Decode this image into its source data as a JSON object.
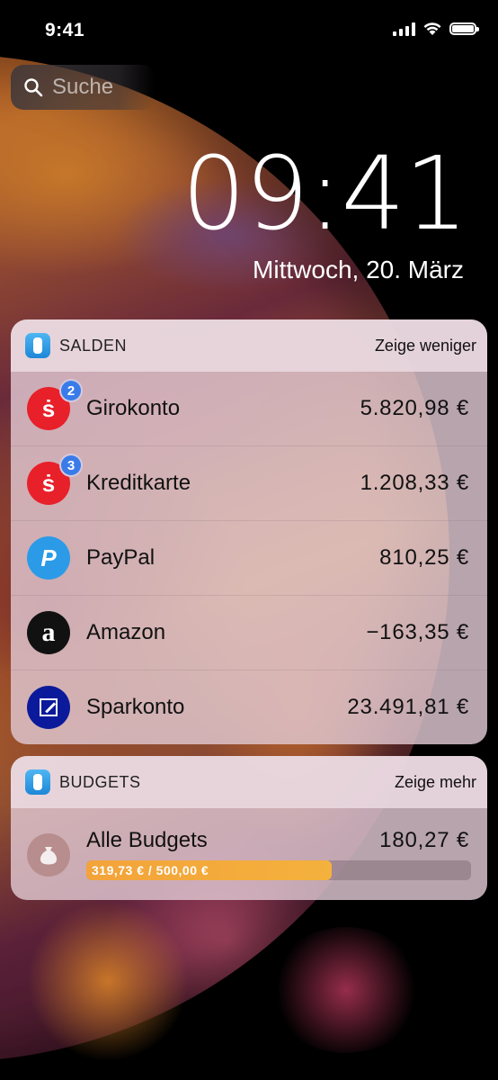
{
  "status_bar": {
    "time": "9:41"
  },
  "search": {
    "placeholder": "Suche"
  },
  "lock_screen": {
    "clock": "09:41",
    "date": "Mittwoch, 20. März"
  },
  "salden": {
    "title": "SALDEN",
    "action": "Zeige weniger",
    "accounts": [
      {
        "name": "Girokonto",
        "balance": "5.820,98 €",
        "badge": "2",
        "icon": "sparkasse-icon"
      },
      {
        "name": "Kreditkarte",
        "balance": "1.208,33 €",
        "badge": "3",
        "icon": "sparkasse-icon"
      },
      {
        "name": "PayPal",
        "balance": "810,25 €",
        "icon": "paypal-icon"
      },
      {
        "name": "Amazon",
        "balance": "−163,35 €",
        "icon": "amazon-icon"
      },
      {
        "name": "Sparkonto",
        "balance": "23.491,81 €",
        "icon": "deutsche-bank-icon"
      }
    ]
  },
  "budgets": {
    "title": "BUDGETS",
    "action": "Zeige mehr",
    "item": {
      "name": "Alle Budgets",
      "remaining": "180,27 €",
      "progress_text": "319,73 € / 500,00 €",
      "progress_fraction": 0.639,
      "progress_color": "#f3a33a",
      "icon": "money-bag-icon"
    }
  },
  "colors": {
    "sparkasse": "#e8202a",
    "paypal": "#2b9be8",
    "amazon": "#111111",
    "deutsche_bank": "#0a1a9a",
    "badge": "#3a7bea"
  }
}
